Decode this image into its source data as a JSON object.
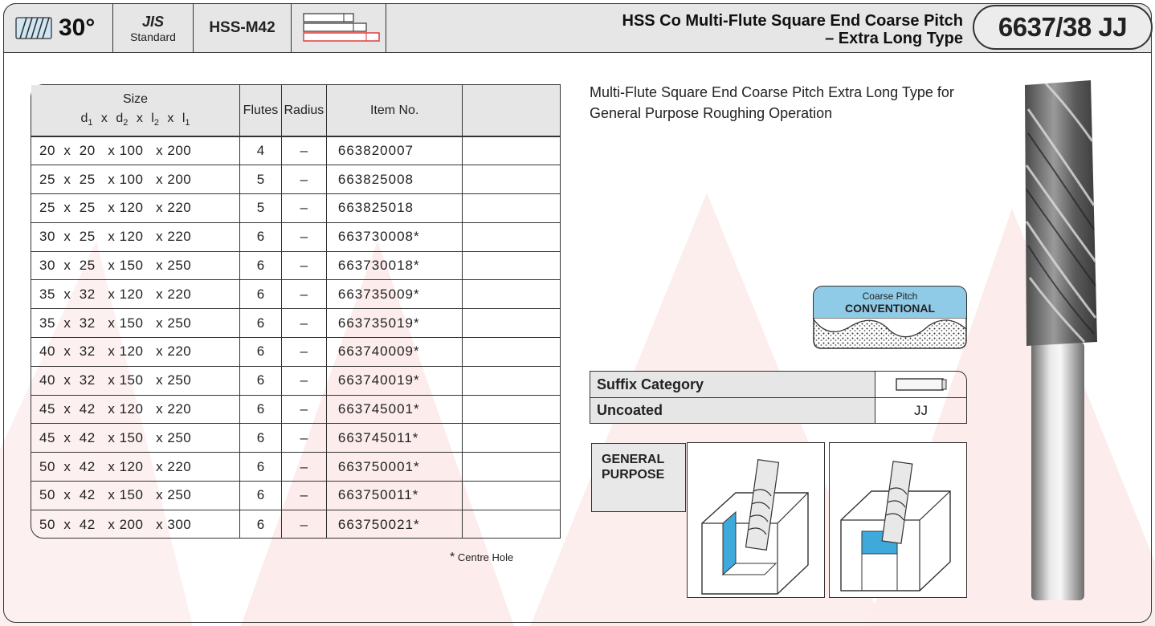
{
  "header": {
    "angle": "30°",
    "standard_main": "JIS",
    "standard_sub": "Standard",
    "material": "HSS-M42",
    "title_line1": "HSS Co Multi-Flute Square End Coarse Pitch",
    "title_line2": "– Extra Long Type",
    "product_code": "6637/38 JJ"
  },
  "table": {
    "size_header": "Size",
    "flutes_header": "Flutes",
    "radius_header": "Radius",
    "item_header": "Item No.",
    "rows": [
      {
        "size": "20  x  20   x 100   x 200",
        "flutes": "4",
        "radius": "–",
        "item": "663820007"
      },
      {
        "size": "25  x  25   x 100   x 200",
        "flutes": "5",
        "radius": "–",
        "item": "663825008"
      },
      {
        "size": "25  x  25   x 120   x 220",
        "flutes": "5",
        "radius": "–",
        "item": "663825018"
      },
      {
        "size": "30  x  25   x 120   x 220",
        "flutes": "6",
        "radius": "–",
        "item": "663730008*"
      },
      {
        "size": "30  x  25   x 150   x 250",
        "flutes": "6",
        "radius": "–",
        "item": "663730018*"
      },
      {
        "size": "35  x  32   x 120   x 220",
        "flutes": "6",
        "radius": "–",
        "item": "663735009*"
      },
      {
        "size": "35  x  32   x 150   x 250",
        "flutes": "6",
        "radius": "–",
        "item": "663735019*"
      },
      {
        "size": "40  x  32   x 120   x 220",
        "flutes": "6",
        "radius": "–",
        "item": "663740009*"
      },
      {
        "size": "40  x  32   x 150   x 250",
        "flutes": "6",
        "radius": "–",
        "item": "663740019*"
      },
      {
        "size": "45  x  42   x 120   x 220",
        "flutes": "6",
        "radius": "–",
        "item": "663745001*"
      },
      {
        "size": "45  x  42   x 150   x 250",
        "flutes": "6",
        "radius": "–",
        "item": "663745011*"
      },
      {
        "size": "50  x  42   x 120   x 220",
        "flutes": "6",
        "radius": "–",
        "item": "663750001*"
      },
      {
        "size": "50  x  42   x 150   x 250",
        "flutes": "6",
        "radius": "–",
        "item": "663750011*"
      },
      {
        "size": "50  x  42   x 200   x 300",
        "flutes": "6",
        "radius": "–",
        "item": "663750021*"
      }
    ],
    "footnote_star": "*",
    "footnote": "Centre Hole"
  },
  "description": "Multi-Flute Square End Coarse Pitch Extra Long Type for General Purpose Roughing Operation",
  "badge": {
    "line1": "Coarse Pitch",
    "line2": "CONVENTIONAL",
    "color": "#8fcbe6"
  },
  "suffix": {
    "header": "Suffix Category",
    "row_label": "Uncoated",
    "row_value": "JJ"
  },
  "application": {
    "line1": "GENERAL",
    "line2": "PURPOSE"
  },
  "colors": {
    "header_bg": "#e6e6e6",
    "accent_blue": "#3fa9dc",
    "watermark": "#fbe6e6"
  },
  "icons": [
    "helix-icon",
    "length-icon",
    "end-mill-image"
  ]
}
